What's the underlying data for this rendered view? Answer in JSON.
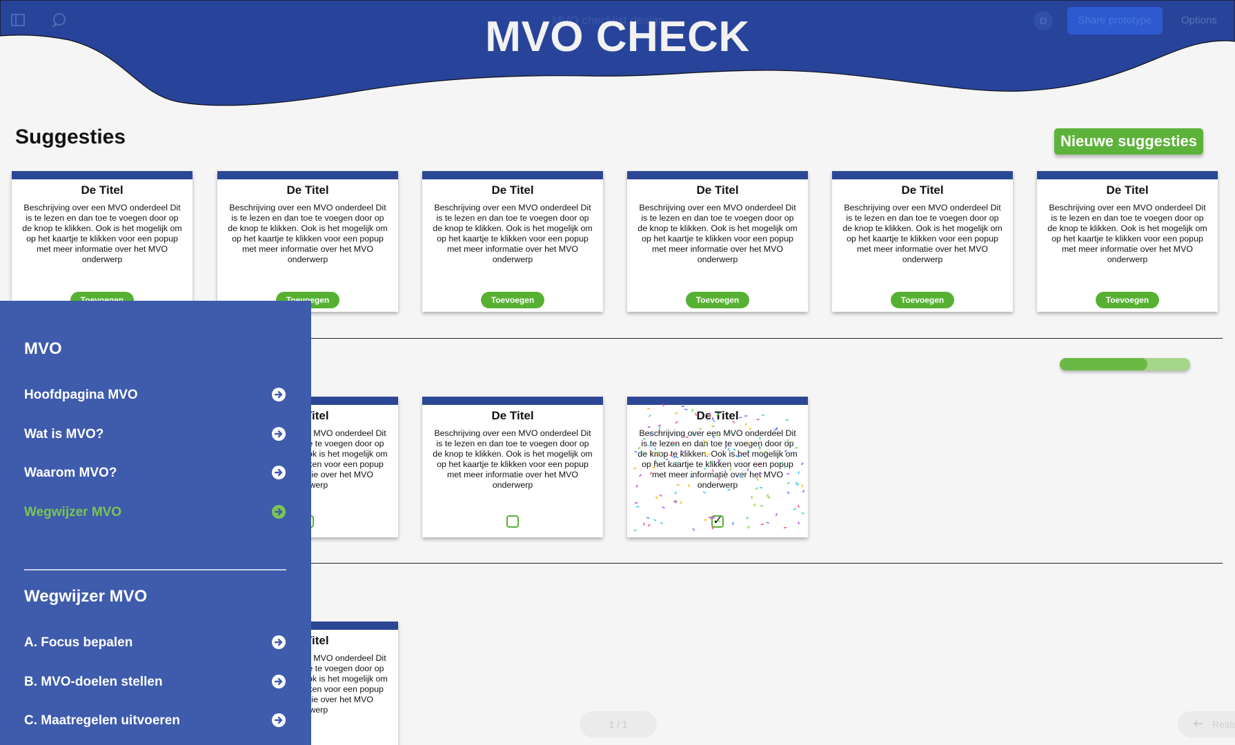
{
  "toolbar": {
    "file_title": "MVO checklist design",
    "avatar_initial": "D",
    "share_label": "Share prototype",
    "options_label": "Options"
  },
  "header": {
    "title": "MVO CHECK"
  },
  "suggestions": {
    "heading": "Suggesties",
    "new_button": "Nieuwe suggesties",
    "cards": [
      {
        "title": "De Titel",
        "description": "Beschrijving over een MVO onderdeel Dit is te lezen en dan toe te voegen door op de knop te klikken. Ook is het mogelijk om op het kaartje te klikken voor een popup met meer informatie over het MVO onderwerp",
        "button": "Toevoegen"
      },
      {
        "title": "De Titel",
        "description": "Beschrijving over een MVO onderdeel Dit is te lezen en dan toe te voegen door op de knop te klikken. Ook is het mogelijk om op het kaartje te klikken voor een popup met meer informatie over het MVO onderwerp",
        "button": "Toevoegen"
      },
      {
        "title": "De Titel",
        "description": "Beschrijving over een MVO onderdeel Dit is te lezen en dan toe te voegen door op de knop te klikken. Ook is het mogelijk om op het kaartje te klikken voor een popup met meer informatie over het MVO onderwerp",
        "button": "Toevoegen"
      },
      {
        "title": "De Titel",
        "description": "Beschrijving over een MVO onderdeel Dit is te lezen en dan toe te voegen door op de knop te klikken. Ook is het mogelijk om op het kaartje te klikken voor een popup met meer informatie over het MVO onderwerp",
        "button": "Toevoegen"
      },
      {
        "title": "De Titel",
        "description": "Beschrijving over een MVO onderdeel Dit is te lezen en dan toe te voegen door op de knop te klikken. Ook is het mogelijk om op het kaartje te klikken voor een popup met meer informatie over het MVO onderwerp",
        "button": "Toevoegen"
      },
      {
        "title": "De Titel",
        "description": "Beschrijving over een MVO onderdeel Dit is te lezen en dan toe te voegen door op de knop te klikken. Ook is het mogelijk om op het kaartje te klikken voor een popup met meer informatie over het MVO onderwerp",
        "button": "Toevoegen"
      }
    ]
  },
  "checklist": {
    "progress_fraction": 0.67,
    "cards": [
      {
        "title": "De Titel",
        "description": "Beschrijving over een MVO onderdeel Dit is te lezen en dan toe te voegen door op de knop te klikken. Ook is het mogelijk om op het kaartje te klikken voor een popup met meer informatie over het MVO onderwerp",
        "checked": false
      },
      {
        "title": "De Titel",
        "description": "Beschrijving over een MVO onderdeel Dit is te lezen en dan toe te voegen door op de knop te klikken. Ook is het mogelijk om op het kaartje te klikken voor een popup met meer informatie over het MVO onderwerp",
        "checked": false
      },
      {
        "title": "De Titel",
        "description": "Beschrijving over een MVO onderdeel Dit is te lezen en dan toe te voegen door op de knop te klikken. Ook is het mogelijk om op het kaartje te klikken voor een popup met meer informatie over het MVO onderwerp",
        "checked": true
      }
    ],
    "third_row_card": {
      "title": "De Titel",
      "description": "Beschrijving over een MVO onderdeel Dit is te lezen en dan toe te voegen door op de knop te klikken. Ook is het mogelijk om op het kaartje te klikken voor een popup met meer informatie over het MVO onderwerp"
    }
  },
  "sidebar": {
    "heading_main": "MVO",
    "items_main": [
      {
        "label": "Hoofdpagina MVO",
        "active": false
      },
      {
        "label": "Wat is MVO?",
        "active": false
      },
      {
        "label": "Waarom MVO?",
        "active": false
      },
      {
        "label": "Wegwijzer MVO",
        "active": true
      }
    ],
    "heading_sub": "Wegwijzer MVO",
    "items_sub": [
      {
        "label": "A. Focus bepalen"
      },
      {
        "label": "B. MVO-doelen stellen"
      },
      {
        "label": "C. Maatregelen uitvoeren"
      }
    ]
  },
  "footer": {
    "pager_label": "1 / 1",
    "restart_label": "Restart"
  },
  "colors": {
    "brand_blue": "#2c4895",
    "sidebar_blue": "#3e5bac",
    "accent_green": "#56b132",
    "active_green": "#7cc454"
  },
  "icons": [
    "sidebar-panel-icon",
    "comment-icon",
    "arrow-right-circle-icon",
    "restart-arrow-icon"
  ]
}
